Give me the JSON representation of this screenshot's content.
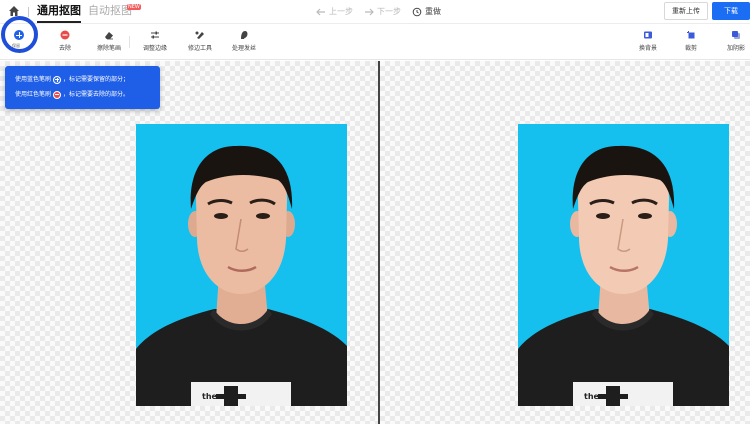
{
  "topbar": {
    "tab_active": "通用抠图",
    "tab_inactive": "自动抠图",
    "new_badge": "NEW",
    "undo_label": "上一步",
    "redo_label": "下一步",
    "reset_label": "重做",
    "reupload_label": "重新上传",
    "download_label": "下载"
  },
  "toolbar": {
    "brush_label": "保留",
    "tools": [
      {
        "label": "去除"
      },
      {
        "label": "擦除笔画"
      },
      {
        "label": "调整边缘"
      },
      {
        "label": "修边工具"
      },
      {
        "label": "处理发丝"
      }
    ],
    "right_tools": [
      {
        "label": "换背景"
      },
      {
        "label": "裁剪"
      },
      {
        "label": "加阴影"
      }
    ]
  },
  "tooltip": {
    "line1_prefix": "使用蓝色笔刷",
    "line1_suffix": "，标记需要保留的部分；",
    "line2_prefix": "使用红色笔刷",
    "line2_suffix": "，标记需要去除的部分。"
  },
  "photo": {
    "shirt_text": "the"
  },
  "colors": {
    "primary": "#1b6ef3",
    "photo_bg": "#15c0ef",
    "tooltip_bg": "#1f5ee6",
    "remove_red": "#e84a4a"
  }
}
